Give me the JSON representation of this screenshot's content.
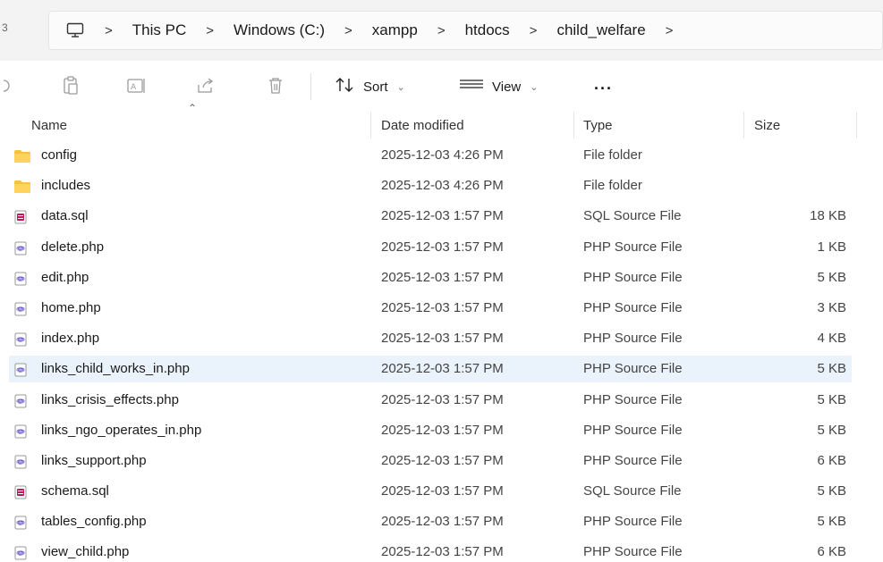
{
  "address": {
    "edge_glyph": "3",
    "icon": "computer-icon",
    "crumbs": [
      "This PC",
      "Windows (C:)",
      "xampp",
      "htdocs",
      "child_welfare"
    ],
    "separator": ">"
  },
  "toolbar": {
    "sort_label": "Sort",
    "view_label": "View",
    "more_label": "...",
    "icons": [
      "cut-icon",
      "paste-icon",
      "rename-icon",
      "share-icon",
      "delete-icon"
    ]
  },
  "columns": {
    "name": "Name",
    "date": "Date modified",
    "type": "Type",
    "size": "Size"
  },
  "files": [
    {
      "name": "config",
      "date": "2025-12-03 4:26 PM",
      "type": "File folder",
      "size": "",
      "icon": "folder"
    },
    {
      "name": "includes",
      "date": "2025-12-03 4:26 PM",
      "type": "File folder",
      "size": "",
      "icon": "folder"
    },
    {
      "name": "data.sql",
      "date": "2025-12-03 1:57 PM",
      "type": "SQL Source File",
      "size": "18 KB",
      "icon": "sql"
    },
    {
      "name": "delete.php",
      "date": "2025-12-03 1:57 PM",
      "type": "PHP Source File",
      "size": "1 KB",
      "icon": "php"
    },
    {
      "name": "edit.php",
      "date": "2025-12-03 1:57 PM",
      "type": "PHP Source File",
      "size": "5 KB",
      "icon": "php"
    },
    {
      "name": "home.php",
      "date": "2025-12-03 1:57 PM",
      "type": "PHP Source File",
      "size": "3 KB",
      "icon": "php"
    },
    {
      "name": "index.php",
      "date": "2025-12-03 1:57 PM",
      "type": "PHP Source File",
      "size": "4 KB",
      "icon": "php"
    },
    {
      "name": "links_child_works_in.php",
      "date": "2025-12-03 1:57 PM",
      "type": "PHP Source File",
      "size": "5 KB",
      "icon": "php",
      "selected": true
    },
    {
      "name": "links_crisis_effects.php",
      "date": "2025-12-03 1:57 PM",
      "type": "PHP Source File",
      "size": "5 KB",
      "icon": "php"
    },
    {
      "name": "links_ngo_operates_in.php",
      "date": "2025-12-03 1:57 PM",
      "type": "PHP Source File",
      "size": "5 KB",
      "icon": "php"
    },
    {
      "name": "links_support.php",
      "date": "2025-12-03 1:57 PM",
      "type": "PHP Source File",
      "size": "6 KB",
      "icon": "php"
    },
    {
      "name": "schema.sql",
      "date": "2025-12-03 1:57 PM",
      "type": "SQL Source File",
      "size": "5 KB",
      "icon": "sql"
    },
    {
      "name": "tables_config.php",
      "date": "2025-12-03 1:57 PM",
      "type": "PHP Source File",
      "size": "5 KB",
      "icon": "php"
    },
    {
      "name": "view_child.php",
      "date": "2025-12-03 1:57 PM",
      "type": "PHP Source File",
      "size": "6 KB",
      "icon": "php"
    }
  ],
  "colors": {
    "selected_row": "#eaf2fb",
    "folder": "#f5c242",
    "sql_icon": "#c2185b",
    "php_icon": "#6a5acd"
  }
}
